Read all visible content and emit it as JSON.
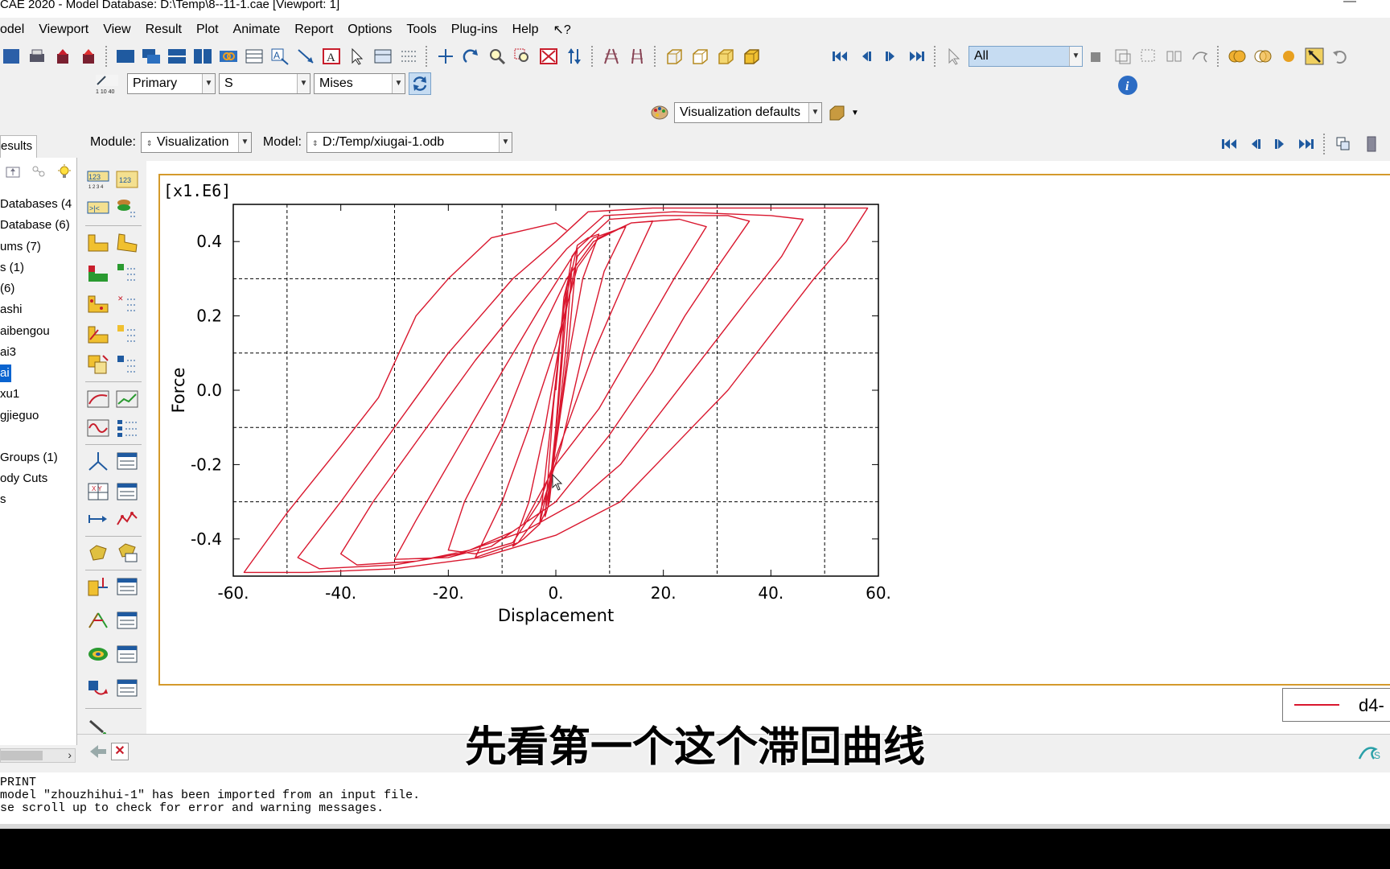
{
  "window": {
    "title": "CAE 2020 - Model Database: D:\\Temp\\8--11-1.cae [Viewport: 1]",
    "min": "—"
  },
  "menu": [
    "odel",
    "Viewport",
    "View",
    "Result",
    "Plot",
    "Animate",
    "Report",
    "Options",
    "Tools",
    "Plug-ins",
    "Help",
    "↖?"
  ],
  "toolbar": {
    "selection_filter": "All",
    "field_output": {
      "invariant_kind": "Primary",
      "variable": "S",
      "invariant": "Mises"
    },
    "visualization_defaults": "Visualization defaults"
  },
  "context": {
    "module_label": "Module:",
    "module_value": "Visualization",
    "model_label": "Model:",
    "model_value": "D:/Temp/xiugai-1.odb"
  },
  "tree": {
    "tab": "esults",
    "items": [
      {
        "label": "Databases (4",
        "sel": false
      },
      {
        "label": "Database (6)",
        "sel": false
      },
      {
        "label": "ums (7)",
        "sel": false
      },
      {
        "label": "s (1)",
        "sel": false
      },
      {
        "label": " (6)",
        "sel": false
      },
      {
        "label": "ashi",
        "sel": false
      },
      {
        "label": "aibengou",
        "sel": false
      },
      {
        "label": "ai3",
        "sel": false
      },
      {
        "label": "ai",
        "sel": true
      },
      {
        "label": "xu1",
        "sel": false
      },
      {
        "label": "gjieguo",
        "sel": false
      },
      {
        "label": "",
        "sel": false
      },
      {
        "label": "Groups (1)",
        "sel": false
      },
      {
        "label": "ody Cuts",
        "sel": false
      },
      {
        "label": "s",
        "sel": false
      }
    ]
  },
  "chart_data": {
    "type": "line",
    "scale_label": "[x1.E6]",
    "xlabel": "Displacement",
    "ylabel": "Force",
    "xlim": [
      -60,
      60
    ],
    "ylim": [
      -0.5,
      0.5
    ],
    "xticks": [
      -60,
      -40,
      -20,
      0,
      20,
      40,
      60
    ],
    "xtick_labels": [
      "-60.",
      "-40.",
      "-20.",
      "0.",
      "20.",
      "40.",
      "60."
    ],
    "yticks": [
      -0.4,
      -0.2,
      0.0,
      0.2,
      0.4
    ],
    "ytick_labels": [
      "-0.4",
      "-0.2",
      "0.0",
      "0.2",
      "0.4"
    ],
    "grid_x": [
      -50,
      -30,
      -10,
      10,
      30,
      50
    ],
    "grid_y": [
      -0.3,
      -0.1,
      0.1,
      0.3
    ],
    "grid": true,
    "series_color": "#d9172e",
    "legend_label": "d4-",
    "series": [
      {
        "points": [
          [
            0,
            0
          ],
          [
            1.5,
            0.25
          ],
          [
            2.5,
            0.31
          ],
          [
            1,
            0.05
          ],
          [
            -0.5,
            -0.2
          ],
          [
            -1.5,
            -0.31
          ],
          [
            0,
            -0.1
          ],
          [
            1.5,
            0.18
          ],
          [
            2.5,
            0.3
          ],
          [
            3,
            0.33
          ],
          [
            1.8,
            0.1
          ],
          [
            0.2,
            -0.12
          ],
          [
            -1.2,
            -0.3
          ],
          [
            -2,
            -0.34
          ],
          [
            -0.5,
            -0.05
          ],
          [
            1.2,
            0.2
          ],
          [
            3,
            0.36
          ],
          [
            4,
            0.38
          ],
          [
            2.2,
            0.1
          ],
          [
            0,
            -0.15
          ],
          [
            -2,
            -0.33
          ],
          [
            -3,
            -0.36
          ],
          [
            -1,
            -0.1
          ],
          [
            1.5,
            0.22
          ],
          [
            4,
            0.39
          ],
          [
            6,
            0.41
          ],
          [
            8,
            0.42
          ],
          [
            5,
            0.3
          ],
          [
            2.5,
            0.1
          ],
          [
            -0.5,
            -0.2
          ],
          [
            -3,
            -0.36
          ],
          [
            -6,
            -0.4
          ],
          [
            -8,
            -0.42
          ],
          [
            -5,
            -0.3
          ],
          [
            -2,
            -0.1
          ],
          [
            1,
            0.15
          ],
          [
            4,
            0.36
          ],
          [
            7,
            0.41
          ],
          [
            11,
            0.43
          ],
          [
            13,
            0.44
          ],
          [
            9,
            0.32
          ],
          [
            5,
            0.1
          ],
          [
            1,
            -0.15
          ],
          [
            -3,
            -0.33
          ],
          [
            -7,
            -0.41
          ],
          [
            -11,
            -0.43
          ],
          [
            -15,
            -0.45
          ],
          [
            -10,
            -0.3
          ],
          [
            -5,
            -0.1
          ],
          [
            0,
            0.12
          ],
          [
            4,
            0.33
          ],
          [
            8,
            0.41
          ],
          [
            14,
            0.45
          ],
          [
            18,
            0.455
          ],
          [
            13,
            0.3
          ],
          [
            7,
            0.1
          ],
          [
            2,
            -0.1
          ],
          [
            -3,
            -0.3
          ],
          [
            -8,
            -0.41
          ],
          [
            -15,
            -0.44
          ],
          [
            -20,
            -0.43
          ],
          [
            -17,
            -0.3
          ],
          [
            -10,
            -0.1
          ],
          [
            -4,
            0.12
          ],
          [
            2,
            0.3
          ],
          [
            7,
            0.4
          ],
          [
            14,
            0.45
          ],
          [
            23,
            0.46
          ],
          [
            28,
            0.44
          ],
          [
            22,
            0.3
          ],
          [
            16,
            0.15
          ],
          [
            8,
            -0.05
          ],
          [
            0,
            -0.2
          ],
          [
            -6,
            -0.36
          ],
          [
            -12,
            -0.42
          ],
          [
            -20,
            -0.45
          ],
          [
            -30,
            -0.455
          ],
          [
            -26,
            -0.35
          ],
          [
            -18,
            -0.15
          ],
          [
            -10,
            0.05
          ],
          [
            -3,
            0.22
          ],
          [
            4,
            0.38
          ],
          [
            10,
            0.46
          ],
          [
            20,
            0.47
          ],
          [
            32,
            0.47
          ],
          [
            36,
            0.455
          ],
          [
            30,
            0.33
          ],
          [
            24,
            0.2
          ],
          [
            18,
            0.05
          ],
          [
            10,
            -0.12
          ],
          [
            0,
            -0.3
          ],
          [
            -8,
            -0.38
          ],
          [
            -16,
            -0.43
          ],
          [
            -26,
            -0.46
          ],
          [
            -37,
            -0.47
          ],
          [
            -40,
            -0.44
          ],
          [
            -34,
            -0.3
          ],
          [
            -25,
            -0.12
          ],
          [
            -15,
            0.08
          ],
          [
            -5,
            0.26
          ],
          [
            2,
            0.38
          ],
          [
            9,
            0.47
          ],
          [
            22,
            0.48
          ],
          [
            40,
            0.47
          ],
          [
            46,
            0.46
          ],
          [
            42,
            0.36
          ],
          [
            36,
            0.25
          ],
          [
            28,
            0.1
          ],
          [
            20,
            -0.05
          ],
          [
            12,
            -0.2
          ],
          [
            4,
            -0.3
          ],
          [
            -6,
            -0.38
          ],
          [
            -18,
            -0.44
          ],
          [
            -30,
            -0.47
          ],
          [
            -44,
            -0.48
          ],
          [
            -48,
            -0.45
          ],
          [
            -40,
            -0.3
          ],
          [
            -30,
            -0.1
          ],
          [
            -20,
            0.1
          ],
          [
            -8,
            0.3
          ],
          [
            0,
            0.4
          ],
          [
            6,
            0.48
          ],
          [
            18,
            0.49
          ],
          [
            40,
            0.49
          ],
          [
            58,
            0.49
          ],
          [
            54,
            0.4
          ],
          [
            48,
            0.3
          ],
          [
            40,
            0.15
          ],
          [
            32,
            0.0
          ],
          [
            22,
            -0.15
          ],
          [
            12,
            -0.3
          ],
          [
            0,
            -0.39
          ],
          [
            -14,
            -0.45
          ],
          [
            -30,
            -0.48
          ],
          [
            -46,
            -0.49
          ],
          [
            -58,
            -0.49
          ],
          [
            -57,
            -0.47
          ],
          [
            -50,
            -0.33
          ],
          [
            -40,
            -0.15
          ],
          [
            -33,
            -0.02
          ],
          [
            -26,
            0.2
          ],
          [
            -20,
            0.3
          ],
          [
            -12,
            0.41
          ],
          [
            -6,
            0.43
          ],
          [
            0,
            0.45
          ],
          [
            2,
            0.43
          ]
        ]
      }
    ]
  },
  "subtitle": "先看第一个这个滞回曲线",
  "messages": [
    "PRINT",
    "model \"zhouzhihui-1\" has been imported from an input file.",
    "se scroll up to check for error and warning messages."
  ]
}
